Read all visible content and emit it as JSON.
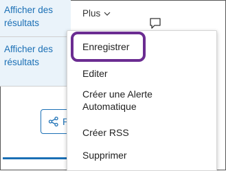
{
  "results": {
    "show_results_1": "Afficher des résultats",
    "show_results_2": "Afficher des résultats"
  },
  "toolbar": {
    "more_label": "Plus"
  },
  "share_button": {
    "label": "Pa"
  },
  "menu": {
    "items": [
      {
        "label": "Enregistrer"
      },
      {
        "label": "Editer"
      },
      {
        "label": "Créer une Alerte Automatique"
      },
      {
        "label": "Créer RSS"
      },
      {
        "label": "Supprimer"
      }
    ]
  },
  "colors": {
    "link": "#1a6fb5",
    "highlight": "#6b2c91"
  }
}
